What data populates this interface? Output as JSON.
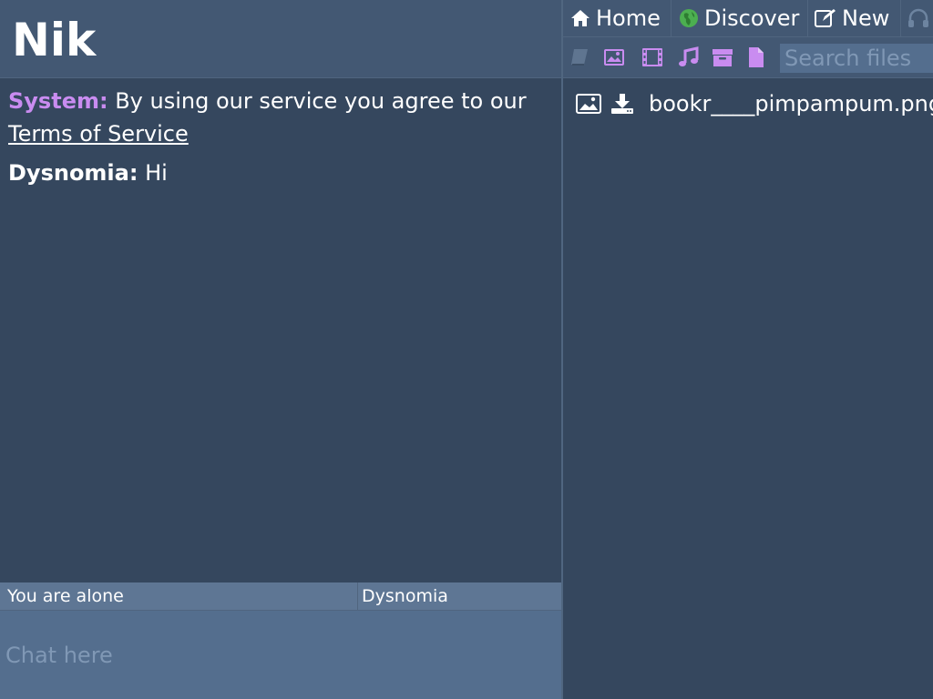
{
  "room": {
    "title": "Nik"
  },
  "messages": [
    {
      "nick": "System:",
      "text": " By using our service you agree to our ",
      "link": "Terms of Service"
    },
    {
      "nick": "Dysnomia:",
      "text": " Hi"
    }
  ],
  "status": {
    "text": "You are alone",
    "users": "Dysnomia"
  },
  "chat": {
    "placeholder": "Chat here"
  },
  "nav": {
    "home": "Home",
    "discover": "Discover",
    "new": "New"
  },
  "filters": {
    "search_placeholder": "Search files"
  },
  "files": [
    {
      "name": "bookr____pimpampum.png"
    }
  ],
  "colors": {
    "accent": "#c98cf0",
    "discover_globe": "#4caf50"
  }
}
